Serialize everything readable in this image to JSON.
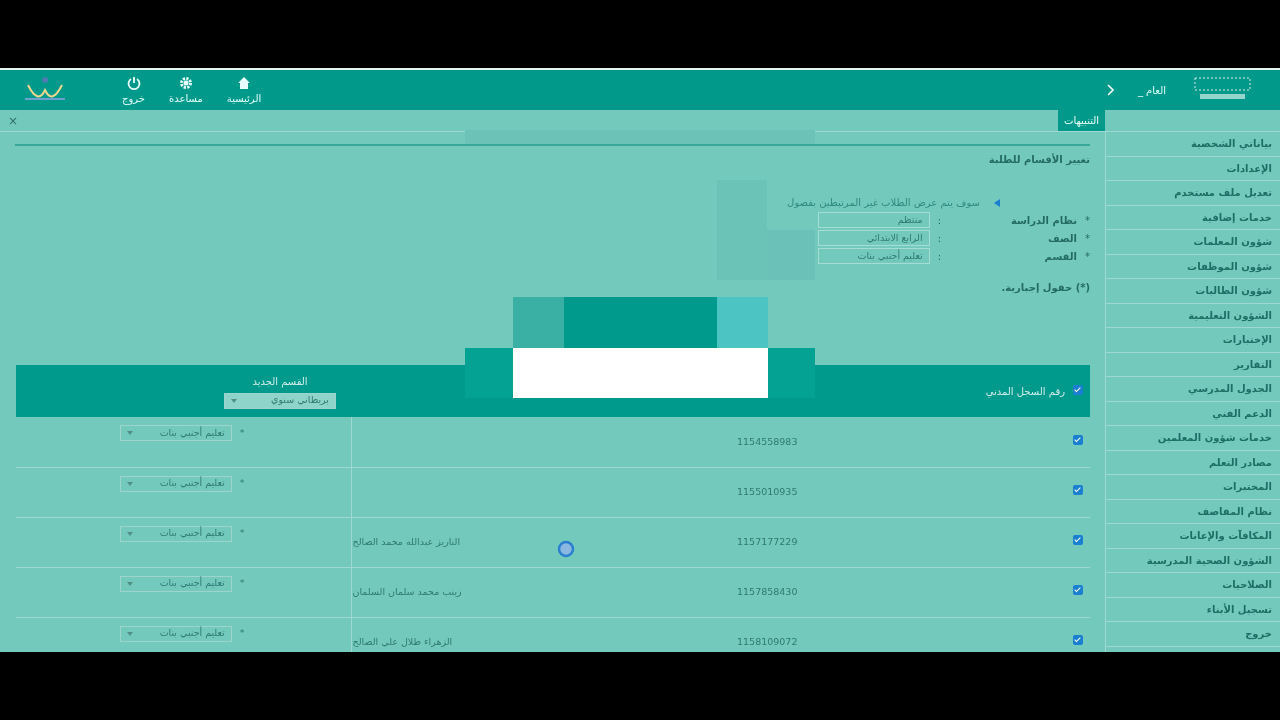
{
  "header": {
    "title_partial": "العام _",
    "nav": [
      {
        "kind": "home",
        "label": "الرئيسية"
      },
      {
        "kind": "gear",
        "label": "مساعدة"
      },
      {
        "kind": "power",
        "label": "خروج"
      }
    ]
  },
  "tabs": [
    {
      "label": "التنبيهات",
      "selected": true
    }
  ],
  "close_label": "×",
  "sidebar": {
    "items": [
      "بياناتي الشخصية",
      "الإعدادات",
      "تعديل ملف مستخدم",
      "خدمات إضافية",
      "شؤون المعلمات",
      "شؤون الموظفات",
      "شؤون الطالبات",
      "الشؤون التعليمية",
      "الإختبارات",
      "التقارير",
      "الجدول المدرسي",
      "الدعم الفني",
      "خدمات شؤون المعلمين",
      "مصادر التعلم",
      "المختبرات",
      "نظام المقاصف",
      "المكافآت والإعانات",
      "الشؤون الصحية المدرسية",
      "الصلاحيات",
      "تسجيل الأبناء",
      "خروج"
    ]
  },
  "form": {
    "title": "تغيير الأقسام للطلبة",
    "note": "سوف يتم عرض الطلاب غير المرتبطين بفصول",
    "fields": [
      {
        "mark": "*",
        "label": "نظام الدراسة",
        "colon": ":",
        "value": "منتظم"
      },
      {
        "mark": "*",
        "label": "الصف",
        "colon": ":",
        "value": "الرابع الابتدائي"
      },
      {
        "mark": "*",
        "label": "القسم",
        "colon": ":",
        "value": "تعليم أجنبي بنات"
      }
    ],
    "required_note": "(*) حقول إجبارية."
  },
  "table": {
    "select_all_checked": true,
    "columns": [
      "رقم السجل المدني",
      "القسم الجديد"
    ],
    "header_select": "بريطاني سنوي",
    "rows": [
      {
        "checked": true,
        "civil_id": "1154558983",
        "mark": "*",
        "section": "تعليم أجنبي بنات"
      },
      {
        "checked": true,
        "civil_id": "1155010935",
        "mark": "*",
        "section": "تعليم أجنبي بنات"
      },
      {
        "checked": true,
        "civil_id": "1157177229",
        "name": "الناريز عبدالله محمد الصالح",
        "mark": "*",
        "section": "تعليم أجنبي بنات"
      },
      {
        "checked": true,
        "civil_id": "1157858430",
        "name": "زينب محمد سلمان السلمان",
        "mark": "*",
        "section": "تعليم أجنبي بنات"
      },
      {
        "checked": true,
        "civil_id": "1158109072",
        "name": "الزهراء طلال علي الصالح",
        "mark": "*",
        "section": "تعليم أجنبي بنات"
      }
    ]
  }
}
